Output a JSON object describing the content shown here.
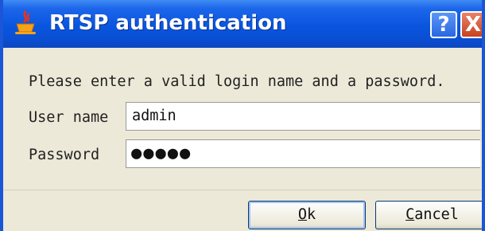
{
  "window": {
    "title": "RTSP authentication",
    "help_label": "?",
    "close_label": "X",
    "icon": "java-cup-icon"
  },
  "form": {
    "prompt": "Please enter a valid login name and a password.",
    "username_label": "User name",
    "username_value": "admin",
    "password_label": "Password",
    "password_masked": "●●●●●"
  },
  "buttons": {
    "ok": {
      "mnemonic": "O",
      "rest": "k"
    },
    "cancel": {
      "mnemonic": "C",
      "rest": "ancel"
    }
  },
  "colors": {
    "titlebar": "#0a55df",
    "frame": "#1a56d6",
    "dialog_bg": "#ece9d8",
    "close_button": "#c9411e"
  }
}
